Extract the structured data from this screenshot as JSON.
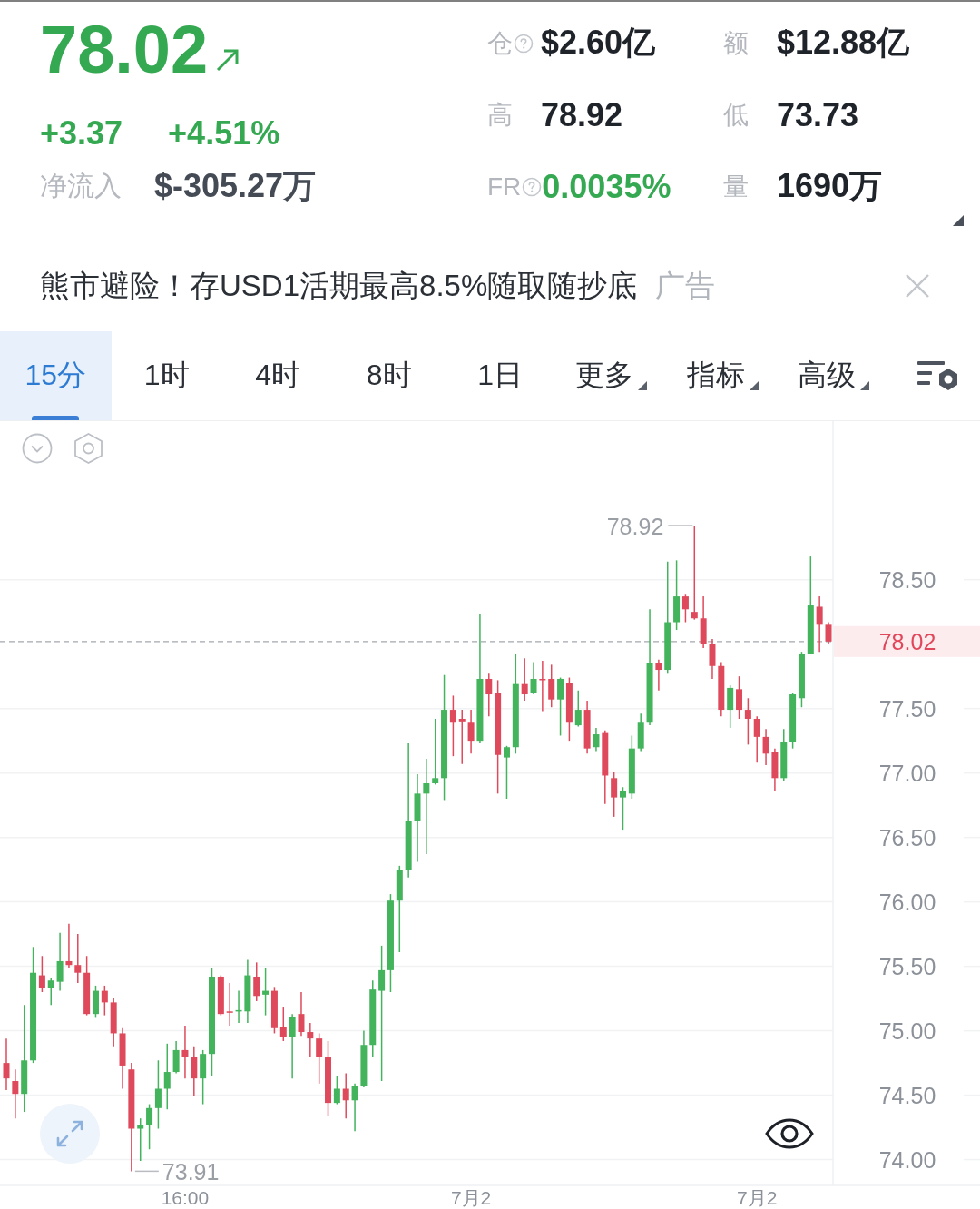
{
  "ticker": {
    "price": "78.02",
    "rising": true,
    "change": "+3.37",
    "change_percent": "+4.51%"
  },
  "net_inflow": {
    "label": "净流入",
    "value": "$-305.27万"
  },
  "stats": [
    {
      "label": "仓",
      "help": true,
      "value": "$2.60亿",
      "positive": false
    },
    {
      "label": "额",
      "help": false,
      "value": "$12.88亿",
      "positive": false
    },
    {
      "label": "高",
      "help": false,
      "value": "78.92",
      "positive": false
    },
    {
      "label": "低",
      "help": false,
      "value": "73.73",
      "positive": false
    },
    {
      "label": "FR",
      "help": true,
      "value": "0.0035%",
      "positive": true
    },
    {
      "label": "量",
      "help": false,
      "value": "1690万",
      "positive": false
    }
  ],
  "ad_banner": {
    "text": "熊市避险！存USD1活期最高8.5%随取随抄底",
    "tag": "广告"
  },
  "timeframe_tabs": [
    {
      "label": "15分",
      "selected": true,
      "dropdown": false
    },
    {
      "label": "1时",
      "selected": false,
      "dropdown": false
    },
    {
      "label": "4时",
      "selected": false,
      "dropdown": false
    },
    {
      "label": "8时",
      "selected": false,
      "dropdown": false
    },
    {
      "label": "1日",
      "selected": false,
      "dropdown": false
    },
    {
      "label": "更多",
      "selected": false,
      "dropdown": true
    },
    {
      "label": "指标",
      "selected": false,
      "dropdown": true
    },
    {
      "label": "高级",
      "selected": false,
      "dropdown": true
    }
  ],
  "chart": {
    "chart_data": {
      "type": "candlestick",
      "categories": [
        null,
        null,
        null,
        null,
        null,
        null,
        null,
        null,
        null,
        null,
        null,
        null,
        null,
        null,
        null,
        null,
        null,
        null,
        null,
        null,
        "16:00",
        null,
        null,
        null,
        null,
        null,
        null,
        null,
        null,
        null,
        null,
        null,
        null,
        null,
        null,
        null,
        null,
        null,
        null,
        null,
        null,
        null,
        null,
        null,
        null,
        null,
        null,
        null,
        null,
        null,
        null,
        null,
        "7月2",
        null,
        null,
        null,
        null,
        null,
        null,
        null,
        null,
        null,
        null,
        null,
        null,
        null,
        null,
        null,
        null,
        null,
        null,
        null,
        null,
        null,
        null,
        null,
        null,
        null,
        null,
        null,
        null,
        null,
        null,
        null,
        "7月2",
        null,
        null,
        null,
        null,
        null,
        null,
        null,
        null
      ],
      "ohlc": [
        [
          74.75,
          74.94,
          74.54,
          74.63
        ],
        [
          74.61,
          74.7,
          74.32,
          74.51
        ],
        [
          74.51,
          75.2,
          74.37,
          74.77
        ],
        [
          74.77,
          75.65,
          74.75,
          75.45
        ],
        [
          75.43,
          75.58,
          75.3,
          75.33
        ],
        [
          75.33,
          75.41,
          75.2,
          75.39
        ],
        [
          75.38,
          75.76,
          75.31,
          75.54
        ],
        [
          75.54,
          75.83,
          75.49,
          75.51
        ],
        [
          75.51,
          75.75,
          75.37,
          75.45
        ],
        [
          75.45,
          75.58,
          75.12,
          75.13
        ],
        [
          75.13,
          75.35,
          75.1,
          75.31
        ],
        [
          75.31,
          75.35,
          75.12,
          75.22
        ],
        [
          75.22,
          75.25,
          74.88,
          74.98
        ],
        [
          74.98,
          75.02,
          74.55,
          74.73
        ],
        [
          74.7,
          74.75,
          73.91,
          74.24
        ],
        [
          74.24,
          74.32,
          73.99,
          74.27
        ],
        [
          74.27,
          74.43,
          74.08,
          74.4
        ],
        [
          74.4,
          74.77,
          74.24,
          74.55
        ],
        [
          74.55,
          74.9,
          74.39,
          74.68
        ],
        [
          74.68,
          74.92,
          74.67,
          74.85
        ],
        [
          74.85,
          75.04,
          74.63,
          74.8
        ],
        [
          74.8,
          74.88,
          74.49,
          74.63
        ],
        [
          74.63,
          74.85,
          74.43,
          74.82
        ],
        [
          74.82,
          75.49,
          74.65,
          75.42
        ],
        [
          75.42,
          75.43,
          75.12,
          75.13
        ],
        [
          75.15,
          75.37,
          75.04,
          75.14
        ],
        [
          75.15,
          75.31,
          75.06,
          75.16
        ],
        [
          75.15,
          75.55,
          75.06,
          75.43
        ],
        [
          75.42,
          75.53,
          75.23,
          75.27
        ],
        [
          75.28,
          75.49,
          75.12,
          75.31
        ],
        [
          75.31,
          75.34,
          74.98,
          75.02
        ],
        [
          75.03,
          75.18,
          74.92,
          74.95
        ],
        [
          74.95,
          75.13,
          74.63,
          75.11
        ],
        [
          75.13,
          75.3,
          74.96,
          74.99
        ],
        [
          74.99,
          75.06,
          74.8,
          74.94
        ],
        [
          74.94,
          74.98,
          74.59,
          74.8
        ],
        [
          74.8,
          74.92,
          74.34,
          74.44
        ],
        [
          74.44,
          74.65,
          74.43,
          74.55
        ],
        [
          74.55,
          74.67,
          74.32,
          74.46
        ],
        [
          74.46,
          74.59,
          74.22,
          74.57
        ],
        [
          74.57,
          75.0,
          74.56,
          74.89
        ],
        [
          74.89,
          75.39,
          74.8,
          75.32
        ],
        [
          75.31,
          75.66,
          74.61,
          75.47
        ],
        [
          75.47,
          76.06,
          75.3,
          76.01
        ],
        [
          76.01,
          76.28,
          75.61,
          76.25
        ],
        [
          76.25,
          77.23,
          76.19,
          76.63
        ],
        [
          76.63,
          76.99,
          76.31,
          76.84
        ],
        [
          76.84,
          77.11,
          76.37,
          76.92
        ],
        [
          76.92,
          77.42,
          76.91,
          76.96
        ],
        [
          76.96,
          77.76,
          76.79,
          77.49
        ],
        [
          77.49,
          77.6,
          77.13,
          77.39
        ],
        [
          77.42,
          77.49,
          77.07,
          77.4
        ],
        [
          77.39,
          77.49,
          77.15,
          77.25
        ],
        [
          77.25,
          78.23,
          77.23,
          77.73
        ],
        [
          77.73,
          77.77,
          77.44,
          77.61
        ],
        [
          77.62,
          77.72,
          76.84,
          77.14
        ],
        [
          77.12,
          77.21,
          76.8,
          77.2
        ],
        [
          77.2,
          77.92,
          77.15,
          77.69
        ],
        [
          77.69,
          77.89,
          77.56,
          77.61
        ],
        [
          77.62,
          77.86,
          77.61,
          77.73
        ],
        [
          77.73,
          77.87,
          77.48,
          77.72
        ],
        [
          77.73,
          77.84,
          77.51,
          77.57
        ],
        [
          77.57,
          77.74,
          77.29,
          77.73
        ],
        [
          77.7,
          77.74,
          77.25,
          77.39
        ],
        [
          77.37,
          77.64,
          77.36,
          77.49
        ],
        [
          77.49,
          77.56,
          77.15,
          77.19
        ],
        [
          77.2,
          77.35,
          77.17,
          77.3
        ],
        [
          77.31,
          77.33,
          76.76,
          76.98
        ],
        [
          76.96,
          77.01,
          76.66,
          76.81
        ],
        [
          76.81,
          76.89,
          76.56,
          76.86
        ],
        [
          76.84,
          77.29,
          76.8,
          77.19
        ],
        [
          77.19,
          77.46,
          77.17,
          77.39
        ],
        [
          77.39,
          78.27,
          77.37,
          77.85
        ],
        [
          77.85,
          77.88,
          77.64,
          77.8
        ],
        [
          77.8,
          78.64,
          77.77,
          78.17
        ],
        [
          78.17,
          78.65,
          78.11,
          78.37
        ],
        [
          78.37,
          78.39,
          78.17,
          78.27
        ],
        [
          78.25,
          78.92,
          78.19,
          78.2
        ],
        [
          78.2,
          78.37,
          77.97,
          78.0
        ],
        [
          78.0,
          78.04,
          77.73,
          77.83
        ],
        [
          77.83,
          77.86,
          77.44,
          77.49
        ],
        [
          77.49,
          77.68,
          77.35,
          77.66
        ],
        [
          77.65,
          77.75,
          77.42,
          77.49
        ],
        [
          77.49,
          77.58,
          77.22,
          77.42
        ],
        [
          77.42,
          77.44,
          77.08,
          77.28
        ],
        [
          77.28,
          77.34,
          77.06,
          77.15
        ],
        [
          77.16,
          77.19,
          76.86,
          76.96
        ],
        [
          76.96,
          77.34,
          76.94,
          77.24
        ],
        [
          77.24,
          77.62,
          77.19,
          77.61
        ],
        [
          77.58,
          77.94,
          77.51,
          77.92
        ],
        [
          77.92,
          78.68,
          77.92,
          78.3
        ],
        [
          78.29,
          78.37,
          77.94,
          78.15
        ],
        [
          78.15,
          78.17,
          78.0,
          78.02
        ]
      ],
      "ylim": [
        73.8,
        79.73
      ],
      "yticks": [
        {
          "value": 78.5,
          "label": "78.50"
        },
        {
          "value": 77.5,
          "label": "77.50"
        },
        {
          "value": 77,
          "label": "77.00"
        },
        {
          "value": 76.5,
          "label": "76.50"
        },
        {
          "value": 76,
          "label": "76.00"
        },
        {
          "value": 75.5,
          "label": "75.50"
        },
        {
          "value": 75,
          "label": "75.00"
        },
        {
          "value": 74.5,
          "label": "74.50"
        },
        {
          "value": 74,
          "label": "74.00"
        }
      ],
      "grid": true,
      "ref_lines": [
        {
          "axis": "y",
          "value": 78.02,
          "label": "78.02"
        }
      ],
      "annotations": [
        "78.92",
        "73.91"
      ]
    }
  }
}
